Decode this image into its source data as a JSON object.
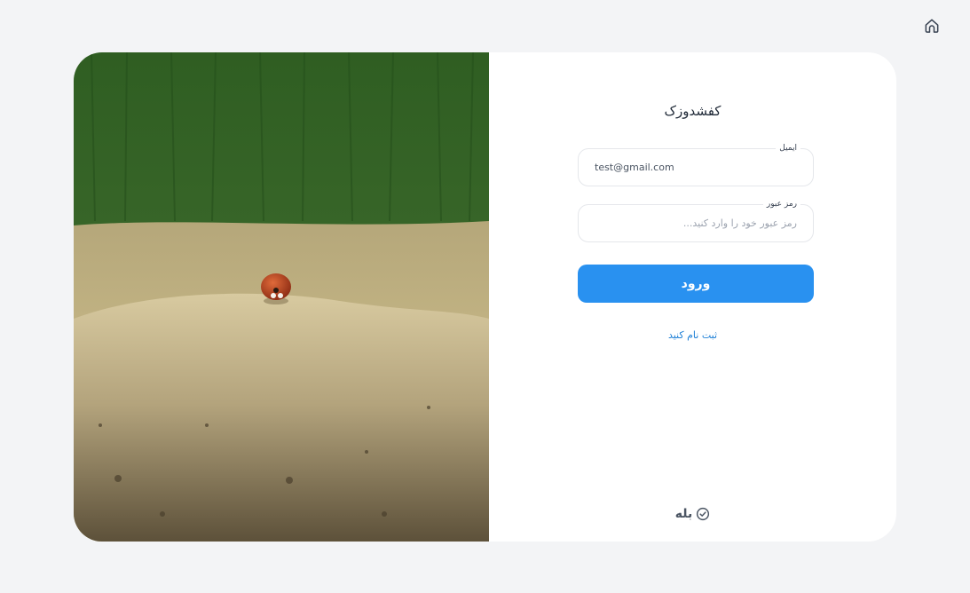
{
  "home": {
    "icon": "home-icon"
  },
  "form": {
    "title": "کفشدوزک",
    "email": {
      "label": "ایمیل",
      "value": "test@gmail.com",
      "placeholder": ""
    },
    "password": {
      "label": "رمز عبور",
      "value": "",
      "placeholder": "رمز عبور خود را وارد کنید..."
    },
    "login_label": "ورود",
    "register_label": "ثبت نام کنید"
  },
  "brand": {
    "name": "بله",
    "icon": "shield-check-icon"
  },
  "colors": {
    "background": "#f3f4f6",
    "primary_button": "#2991f0",
    "link": "#1d7fd6"
  },
  "image": {
    "subject": "ladybug-on-sand-photo",
    "icon": "photo"
  }
}
